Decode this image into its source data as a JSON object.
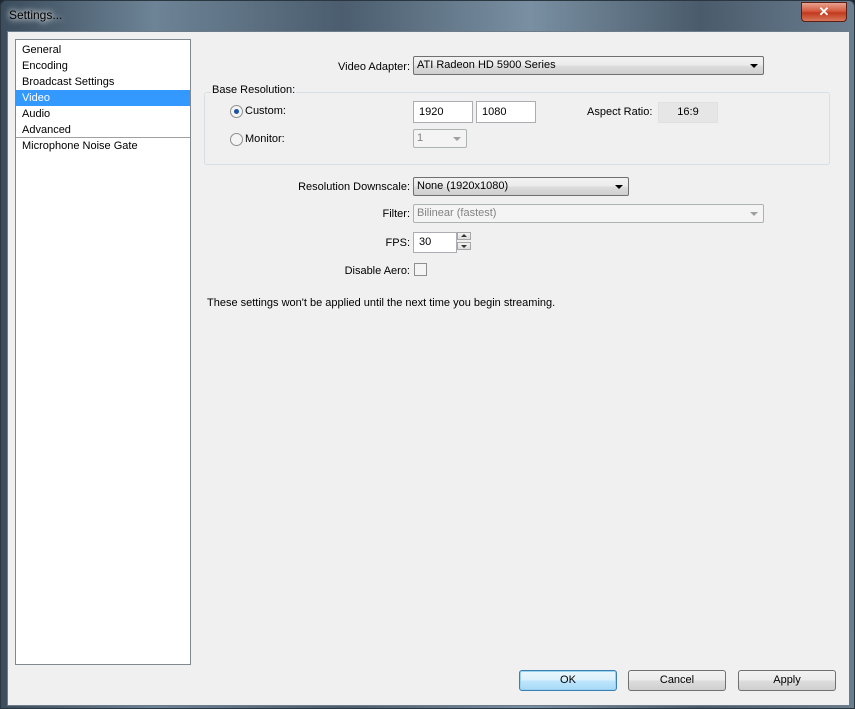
{
  "window": {
    "title": "Settings...",
    "close_glyph": "✕"
  },
  "sidebar": {
    "items": [
      {
        "label": "General"
      },
      {
        "label": "Encoding"
      },
      {
        "label": "Broadcast Settings"
      },
      {
        "label": "Video",
        "selected": true
      },
      {
        "label": "Audio"
      },
      {
        "label": "Advanced"
      },
      {
        "label": "Microphone Noise Gate"
      }
    ]
  },
  "video": {
    "adapter_label": "Video Adapter:",
    "adapter_value": "ATI Radeon HD 5900 Series",
    "base_resolution": {
      "group_label": "Base Resolution:",
      "custom_label": "Custom:",
      "custom_selected": true,
      "width": "1920",
      "height": "1080",
      "aspect_label": "Aspect Ratio:",
      "aspect_value": "16:9",
      "monitor_label": "Monitor:",
      "monitor_value": "1"
    },
    "downscale_label": "Resolution Downscale:",
    "downscale_value": "None  (1920x1080)",
    "filter_label": "Filter:",
    "filter_value": "Bilinear (fastest)",
    "fps_label": "FPS:",
    "fps_value": "30",
    "disable_aero_label": "Disable Aero:",
    "disable_aero_checked": false,
    "notice": "These settings won't be applied until the next time you begin streaming."
  },
  "buttons": {
    "ok": "OK",
    "cancel": "Cancel",
    "apply": "Apply"
  }
}
